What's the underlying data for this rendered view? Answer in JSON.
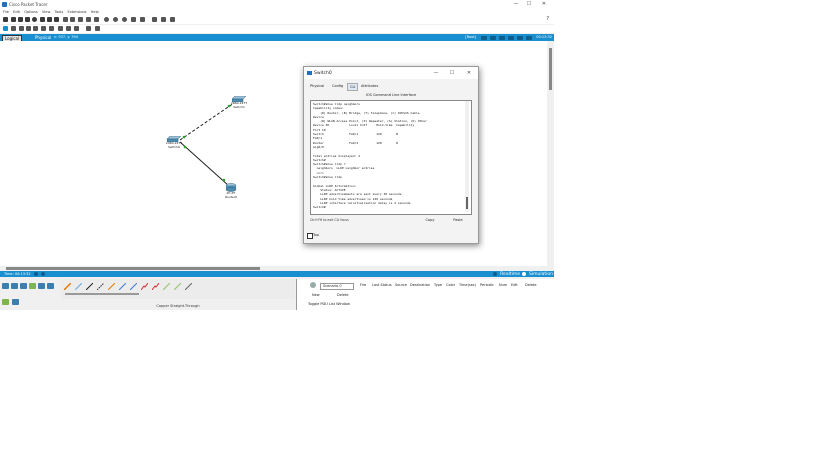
{
  "app": {
    "title": "Cisco Packet Tracer",
    "window_controls": [
      "—",
      "☐",
      "✕"
    ],
    "help_icon": "?"
  },
  "menu": [
    "File",
    "Edit",
    "Options",
    "View",
    "Tools",
    "Extensions",
    "Help"
  ],
  "workspace_bar": {
    "logical_tab": "Logical",
    "physical_tab": "Physical",
    "path": "x: 937, y: 394",
    "root_label": "[Root]",
    "clock": "00:13:32"
  },
  "devices": [
    {
      "model": "2960-24TT",
      "name": "Switch1"
    },
    {
      "model": "2960-24TT",
      "name": "Switch0"
    },
    {
      "model": "PC-PT",
      "name": "Router0"
    }
  ],
  "status": {
    "time_label": "Time: 00:13:32",
    "realtime_label": "Realtime",
    "simulation_label": "Simulation"
  },
  "cable_caption": "Copper Straight-Through",
  "pdu": {
    "scenario": "Scenario 0",
    "new_label": "New",
    "delete_label": "Delete",
    "toggle_label": "Toggle PDU List Window",
    "columns": [
      "Fire",
      "Last Status",
      "Source",
      "Destination",
      "Type",
      "Color",
      "Time(sec)",
      "Periodic",
      "Num",
      "Edit",
      "Delete"
    ]
  },
  "dialog": {
    "title": "Switch0",
    "controls": [
      "—",
      "☐",
      "✕"
    ],
    "tabs": [
      "Physical",
      "Config",
      "CLI",
      "Attributes"
    ],
    "active_tab": "CLI",
    "header": "IOS Command Line Interface",
    "console_text": "Switch#show lldp neighbors\nCapability codes:\n    (R) Router, (B) Bridge, (T) Telephone, (C) DOCSIS Cable\nDevice\n    (W) WLAN Access Point, (P) Repeater, (S) Station, (O) Other\nDevice ID           Local Intf     Hold-time  Capability\nFort ID\nSwitch              Fa0/1          120        B\nFa0/1\nRouter              Fa0/2          120        R\nGig0/0\n\nTotal entries displayed: 2\nSwitch#\nSwitch#show lldp ?\n  neighbors  LLDP neighbor entries\n  <cr>\nSwitch#show lldp\n\nGlobal LLDP Information:\n    Status: ACTIVE\n    LLDP advertisements are sent every 30 seconds\n    LLDP hold time advertised is 120 seconds\n    LLDP interface reinitialisation delay is 2 seconds\nSwitch#",
    "hint": "Ctrl+F6 to exit CLI focus",
    "copy_label": "Copy",
    "paste_label": "Paste",
    "top_label": "Top"
  },
  "colors": {
    "accent_blue": "#1a8fd0",
    "link_green": "#2aa52a"
  }
}
